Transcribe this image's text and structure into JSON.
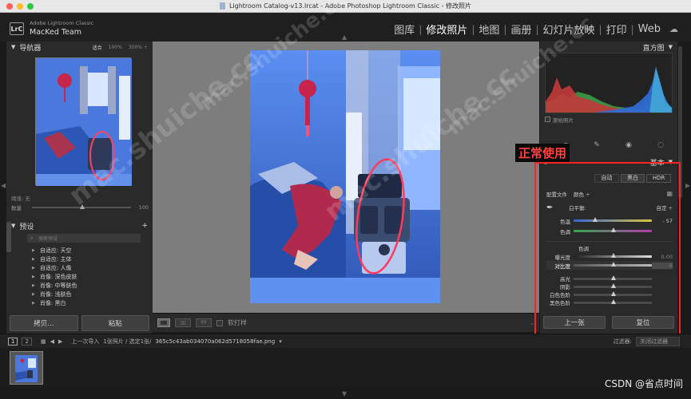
{
  "window": {
    "title": "Lightroom Catalog-v13.lrcat - Adobe Photoshop Lightroom Classic - 修改照片"
  },
  "brand": {
    "logo": "LrC",
    "app": "Adobe Lightroom Classic",
    "user": "MacKed Team"
  },
  "modules": [
    {
      "label": "图库"
    },
    {
      "label": "修改照片"
    },
    {
      "label": "地图"
    },
    {
      "label": "画册"
    },
    {
      "label": "幻灯片放映"
    },
    {
      "label": "打印"
    },
    {
      "label": "Web"
    }
  ],
  "navigator": {
    "title": "导航器",
    "zoom": [
      "适合",
      "100%",
      "300%"
    ]
  },
  "left_sliders": {
    "label1": "阈值: 无",
    "label2": "数量",
    "value2": "100"
  },
  "presets": {
    "title": "预设",
    "add": "+",
    "search_placeholder": "搜索预设",
    "items": [
      "自适应: 天空",
      "自适应: 主体",
      "自适应: 人像",
      "肖像: 深色皮肤",
      "肖像: 中等肤色",
      "肖像: 浅肤色",
      "肖像: 黑白"
    ]
  },
  "left_buttons": {
    "copy": "拷贝...",
    "paste": "粘贴"
  },
  "toolbar": {
    "soft_proof": "软打样"
  },
  "histogram": {
    "title": "直方图",
    "original": "原始照片"
  },
  "basic": {
    "title": "基本",
    "modes": [
      "自动",
      "黑白",
      "HDR"
    ],
    "profile_label": "配置文件",
    "profile_value": "颜色 ÷",
    "wb_label": "白平衡:",
    "wb_value": "自定 ÷",
    "temp_label": "色温",
    "temp_value": "- 57",
    "tint_label": "色调",
    "tone_label": "色调",
    "sliders": [
      {
        "label": "曝光度",
        "value": "0.00",
        "pos": 0.5
      },
      {
        "label": "对比度",
        "value": "0",
        "pos": 0.5
      },
      {
        "label": "高光",
        "value": "",
        "pos": 0.5
      },
      {
        "label": "阴影",
        "value": "",
        "pos": 0.5
      },
      {
        "label": "白色色阶",
        "value": "",
        "pos": 0.5
      },
      {
        "label": "黑色色阶",
        "value": "",
        "pos": 0.5
      }
    ]
  },
  "right_buttons": {
    "prev": "上一张",
    "reset": "复位"
  },
  "annotation": {
    "label": "正常使用",
    "color": "#ff2020"
  },
  "filmbar": {
    "page1": "1",
    "page2": "2",
    "source": "上一次导入",
    "count": "1张照片 / 选定1张/",
    "filename": "365c5c43ab034070a062d5718058fae.png",
    "filter_label": "过滤器:",
    "filter_value": "关闭过滤器"
  },
  "watermarks": [
    "mac.shuiche.cc",
    "mac.shuiche.cc",
    "mac.shuiche.cc",
    "mac.shuiche.cc"
  ],
  "credit": "CSDN @省点时间"
}
